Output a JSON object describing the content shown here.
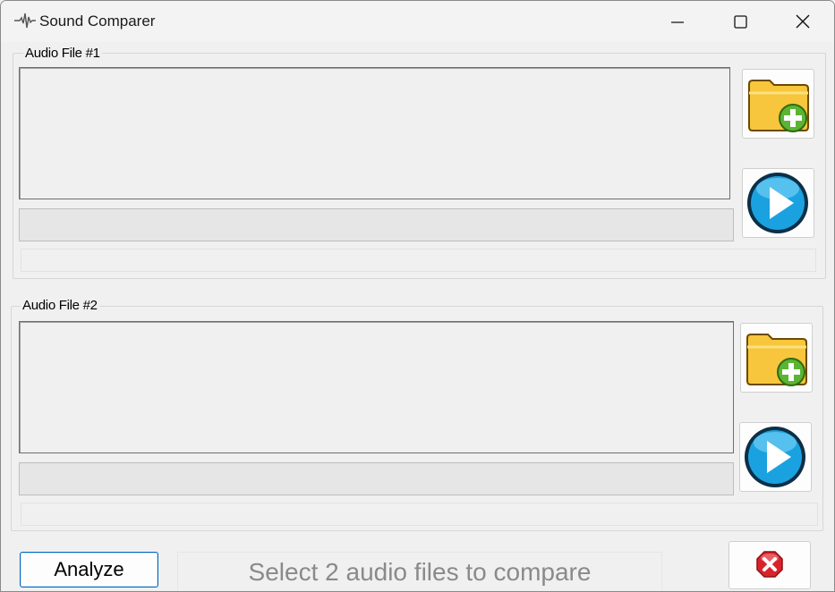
{
  "window": {
    "title": "Sound Comparer",
    "app_icon": "waveform-icon",
    "controls": [
      "minimize-icon",
      "maximize-icon",
      "close-icon"
    ]
  },
  "file1": {
    "label": "Audio File #1",
    "path_value": "",
    "info_text": "",
    "buttons": [
      "add-folder-icon",
      "play-icon"
    ]
  },
  "file2": {
    "label": "Audio File #2",
    "path_value": "",
    "info_text": "",
    "buttons": [
      "add-folder-icon",
      "play-icon"
    ]
  },
  "footer": {
    "analyze_label": "Analyze",
    "status_text": "Select 2 audio files to compare",
    "close_icon": "red-close-icon"
  },
  "colors": {
    "accent": "#0067c0",
    "folder": "#f7c63c",
    "play": "#1aa2e0",
    "close_red": "#d8232a",
    "add_green": "#5bb532"
  }
}
